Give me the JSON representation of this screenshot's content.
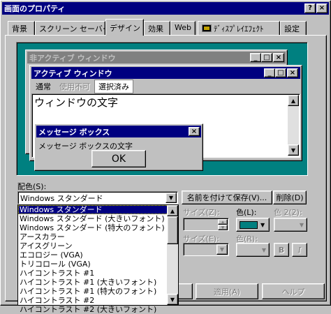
{
  "window": {
    "title": "画面のプロパティ",
    "help_btn": "?",
    "close_btn": "×"
  },
  "tabs": [
    {
      "label": "背景"
    },
    {
      "label": "スクリーン セーバー"
    },
    {
      "label": "デザイン"
    },
    {
      "label": "効果"
    },
    {
      "label": "Web"
    },
    {
      "label": "ﾃﾞｨｽﾌﾟﾚｲｴﾌｪｸﾄ"
    },
    {
      "label": "設定"
    }
  ],
  "preview": {
    "inactive_title": "非アクティブ ウィンドウ",
    "active_title": "アクティブ ウィンドウ",
    "menu_normal": "通常",
    "menu_disabled": "使用不可",
    "menu_selected": "選択済み",
    "window_text": "ウィンドウの文字",
    "msgbox_title": "メッセージ ボックス",
    "msgbox_text": "メッセージ ボックスの文字",
    "ok_label": "OK",
    "colors": {
      "desktop": "#008080",
      "active_title": "#000080",
      "inactive_title": "#808080"
    }
  },
  "scheme": {
    "label": "配色(S):",
    "selected_value": "Windows スタンダード",
    "save_label": "名前を付けて保存(V)...",
    "delete_label": "削除(D)",
    "options": [
      "Windows スタンダード",
      "Windows スタンダード (大きいフォント)",
      "Windows スタンダード (特大のフォント)",
      "アースカラー",
      "アイスグリーン",
      "エコロジー (VGA)",
      "トリコロール (VGA)",
      "ハイコントラスト #1",
      "ハイコントラスト #1 (大きいフォント)",
      "ハイコントラスト #1 (特大のフォント)",
      "ハイコントラスト #2",
      "ハイコントラスト #2 (大きいフォント)"
    ]
  },
  "item_props": {
    "size_label": "サイズ(Z):",
    "color_label": "色(L):",
    "color2_label": "色 2(2):",
    "font_size_label": "サイズ(E):",
    "font_color_label": "色(R):",
    "bold_label": "B",
    "italic_label": "I",
    "color_swatch": "#008080"
  },
  "buttons": {
    "apply": "適用(A)",
    "help": "ヘルプ"
  }
}
